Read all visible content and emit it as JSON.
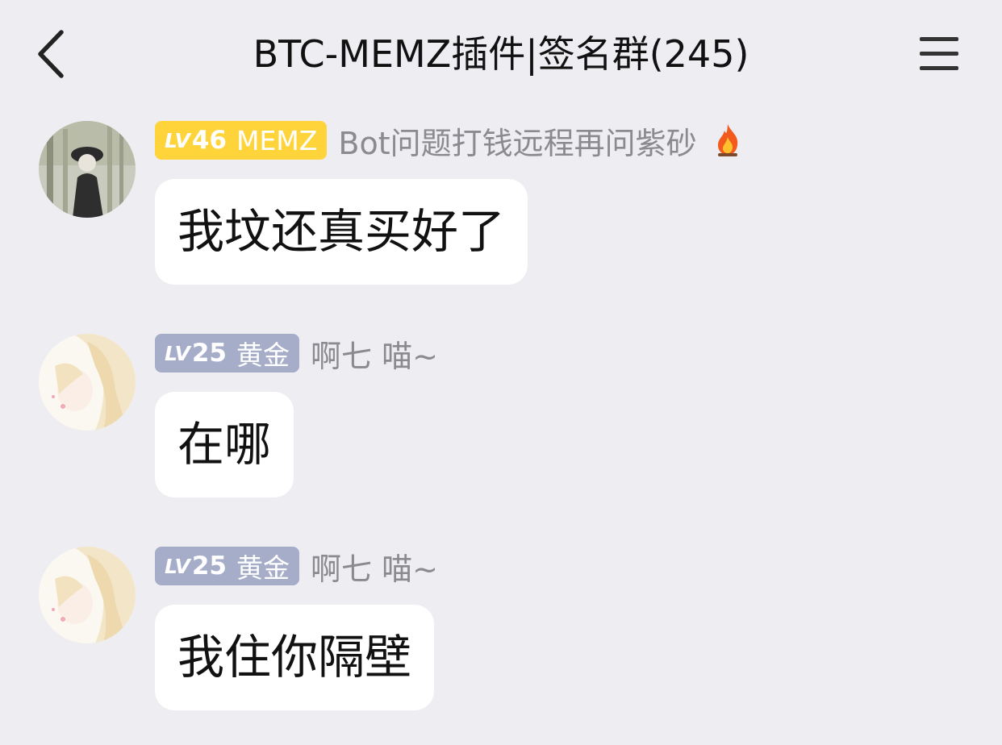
{
  "header": {
    "title": "BTC-MEMZ插件|签名群(245)",
    "back_icon": "chevron-left-icon",
    "menu_icon": "hamburger-menu-icon"
  },
  "messages": [
    {
      "badge": {
        "lv_prefix": "LV",
        "level": "46",
        "rank": "MEMZ",
        "color": "#ffd43b"
      },
      "nickname": "Bot问题打钱远程再问紫砂",
      "nickname_icon": "fire-icon",
      "text": "我坟还真买好了"
    },
    {
      "badge": {
        "lv_prefix": "LV",
        "level": "25",
        "rank": "黄金",
        "color": "#a6adc8"
      },
      "nickname": "啊七 喵~",
      "text": "在哪"
    },
    {
      "badge": {
        "lv_prefix": "LV",
        "level": "25",
        "rank": "黄金",
        "color": "#a6adc8"
      },
      "nickname": "啊七 喵~",
      "text": "我住你隔壁"
    }
  ],
  "colors": {
    "background": "#ededf2",
    "bubble": "#ffffff",
    "nickname": "#8a8a8f"
  }
}
